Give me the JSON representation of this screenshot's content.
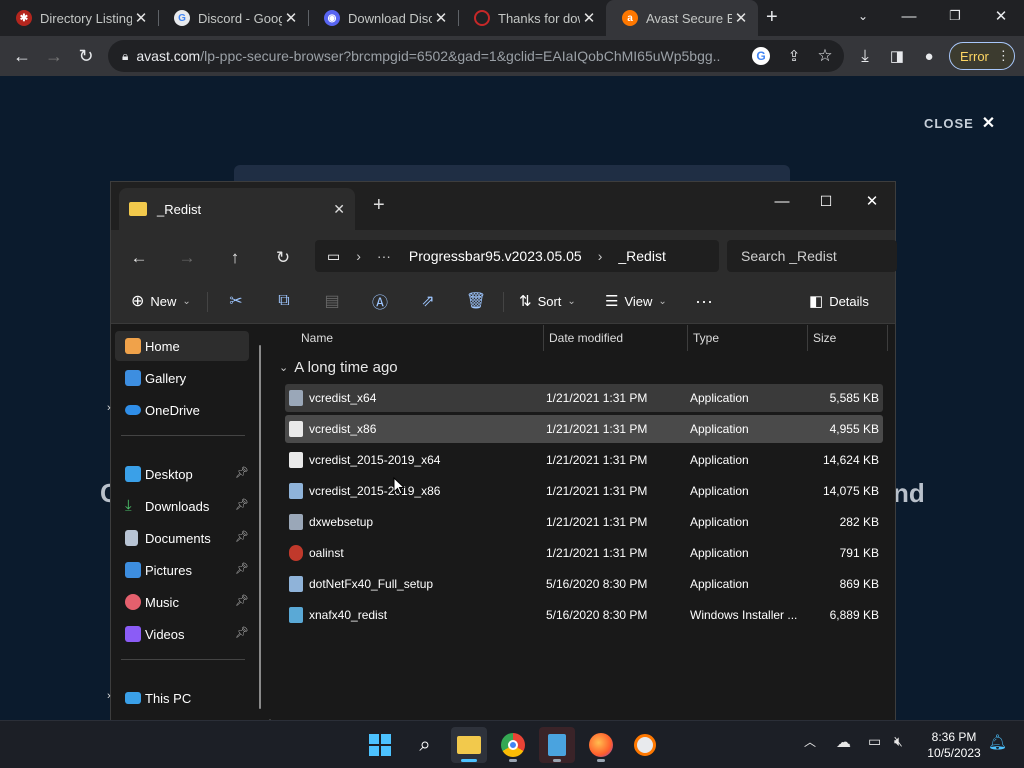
{
  "browser": {
    "tabs": [
      {
        "title": "Directory Listing",
        "favicon_color": "#b3261e"
      },
      {
        "title": "Discord - Google",
        "favicon_color": "#e8eaed"
      },
      {
        "title": "Download Discord",
        "favicon_color": "#5865f2"
      },
      {
        "title": "Thanks for down",
        "favicon_color": "#c62828"
      },
      {
        "title": "Avast Secure Br",
        "favicon_color": "#ff7800"
      }
    ],
    "url_host": "avast.com",
    "url_path": "/lp-ppc-secure-browser?brcmpgid=6502&gad=1&gclid=EAIaIQobChMI65uWp5bgg...",
    "error_label": "Error"
  },
  "page": {
    "close_label": "CLOSE",
    "text_left": "C",
    "text_right": "nd"
  },
  "explorer": {
    "tab_title": "_Redist",
    "breadcrumb": [
      "Progressbar95.v2023.05.05",
      "_Redist"
    ],
    "search_placeholder": "Search _Redist",
    "commands": {
      "new": "New",
      "sort": "Sort",
      "view": "View",
      "details": "Details"
    },
    "sidebar": {
      "home": "Home",
      "gallery": "Gallery",
      "onedrive": "OneDrive",
      "desktop": "Desktop",
      "downloads": "Downloads",
      "documents": "Documents",
      "pictures": "Pictures",
      "music": "Music",
      "videos": "Videos",
      "thispc": "This PC"
    },
    "columns": {
      "name": "Name",
      "date": "Date modified",
      "type": "Type",
      "size": "Size"
    },
    "group_label": "A long time ago",
    "files": [
      {
        "name": "vcredist_x64",
        "date": "1/21/2021 1:31 PM",
        "type": "Application",
        "size": "5,585 KB"
      },
      {
        "name": "vcredist_x86",
        "date": "1/21/2021 1:31 PM",
        "type": "Application",
        "size": "4,955 KB"
      },
      {
        "name": "vcredist_2015-2019_x64",
        "date": "1/21/2021 1:31 PM",
        "type": "Application",
        "size": "14,624 KB"
      },
      {
        "name": "vcredist_2015-2019_x86",
        "date": "1/21/2021 1:31 PM",
        "type": "Application",
        "size": "14,075 KB"
      },
      {
        "name": "dxwebsetup",
        "date": "1/21/2021 1:31 PM",
        "type": "Application",
        "size": "282 KB"
      },
      {
        "name": "oalinst",
        "date": "1/21/2021 1:31 PM",
        "type": "Application",
        "size": "791 KB"
      },
      {
        "name": "dotNetFx40_Full_setup",
        "date": "5/16/2020 8:30 PM",
        "type": "Application",
        "size": "869 KB"
      },
      {
        "name": "xnafx40_redist",
        "date": "5/16/2020 8:30 PM",
        "type": "Windows Installer ...",
        "size": "6,889 KB"
      }
    ]
  },
  "taskbar": {
    "time": "8:36 PM",
    "date": "10/5/2023"
  }
}
